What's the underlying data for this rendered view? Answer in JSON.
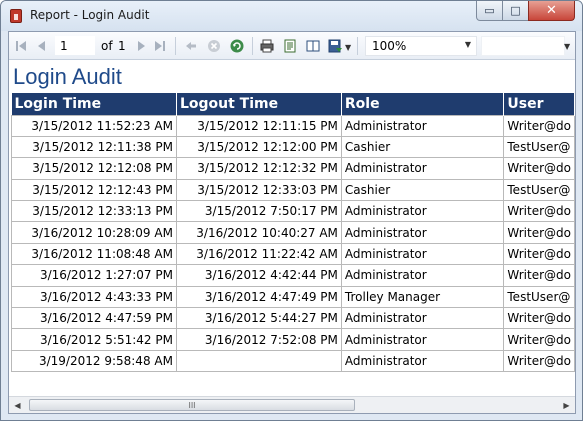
{
  "window": {
    "title": "Report - Login Audit",
    "controls": {
      "minimize": "▭",
      "maximize": "□",
      "close": "✕"
    }
  },
  "toolbar": {
    "page_number": "1",
    "of_label": "of",
    "total_pages": "1",
    "zoom": "100%",
    "icons": [
      "first-page-icon",
      "previous-page-icon",
      "next-page-icon",
      "last-page-icon",
      "back-icon",
      "stop-icon",
      "refresh-icon",
      "print-icon",
      "page-setup-icon",
      "print-layout-icon",
      "export-icon"
    ]
  },
  "report": {
    "title": "Login Audit",
    "columns": [
      "Login Time",
      "Logout Time",
      "Role",
      "User"
    ],
    "rows": [
      {
        "login": "3/15/2012 11:52:23 AM",
        "logout": "3/15/2012 12:11:15 PM",
        "role": "Administrator",
        "user": "Writer@do"
      },
      {
        "login": "3/15/2012 12:11:38 PM",
        "logout": "3/15/2012 12:12:00 PM",
        "role": "Cashier",
        "user": "TestUser@"
      },
      {
        "login": "3/15/2012 12:12:08 PM",
        "logout": "3/15/2012 12:12:32 PM",
        "role": "Administrator",
        "user": "Writer@do"
      },
      {
        "login": "3/15/2012 12:12:43 PM",
        "logout": "3/15/2012 12:33:03 PM",
        "role": "Cashier",
        "user": "TestUser@"
      },
      {
        "login": "3/15/2012 12:33:13 PM",
        "logout": "3/15/2012 7:50:17 PM",
        "role": "Administrator",
        "user": "Writer@do"
      },
      {
        "login": "3/16/2012 10:28:09 AM",
        "logout": "3/16/2012 10:40:27 AM",
        "role": "Administrator",
        "user": "Writer@do"
      },
      {
        "login": "3/16/2012 11:08:48 AM",
        "logout": "3/16/2012 11:22:42 AM",
        "role": "Administrator",
        "user": "Writer@do"
      },
      {
        "login": "3/16/2012 1:27:07 PM",
        "logout": "3/16/2012 4:42:44 PM",
        "role": "Administrator",
        "user": "Writer@do"
      },
      {
        "login": "3/16/2012 4:43:33 PM",
        "logout": "3/16/2012 4:47:49 PM",
        "role": "Trolley Manager",
        "user": "TestUser@"
      },
      {
        "login": "3/16/2012 4:47:59 PM",
        "logout": "3/16/2012 5:44:27 PM",
        "role": "Administrator",
        "user": "Writer@do"
      },
      {
        "login": "3/16/2012 5:51:42 PM",
        "logout": "3/16/2012 7:52:08 PM",
        "role": "Administrator",
        "user": "Writer@do"
      },
      {
        "login": "3/19/2012 9:58:48 AM",
        "logout": "",
        "role": "Administrator",
        "user": "Writer@do"
      }
    ]
  },
  "scrollbar": {
    "thumb_grip": "III"
  },
  "colors": {
    "header_bg": "#1f3c6e",
    "title": "#1f4a8a"
  }
}
